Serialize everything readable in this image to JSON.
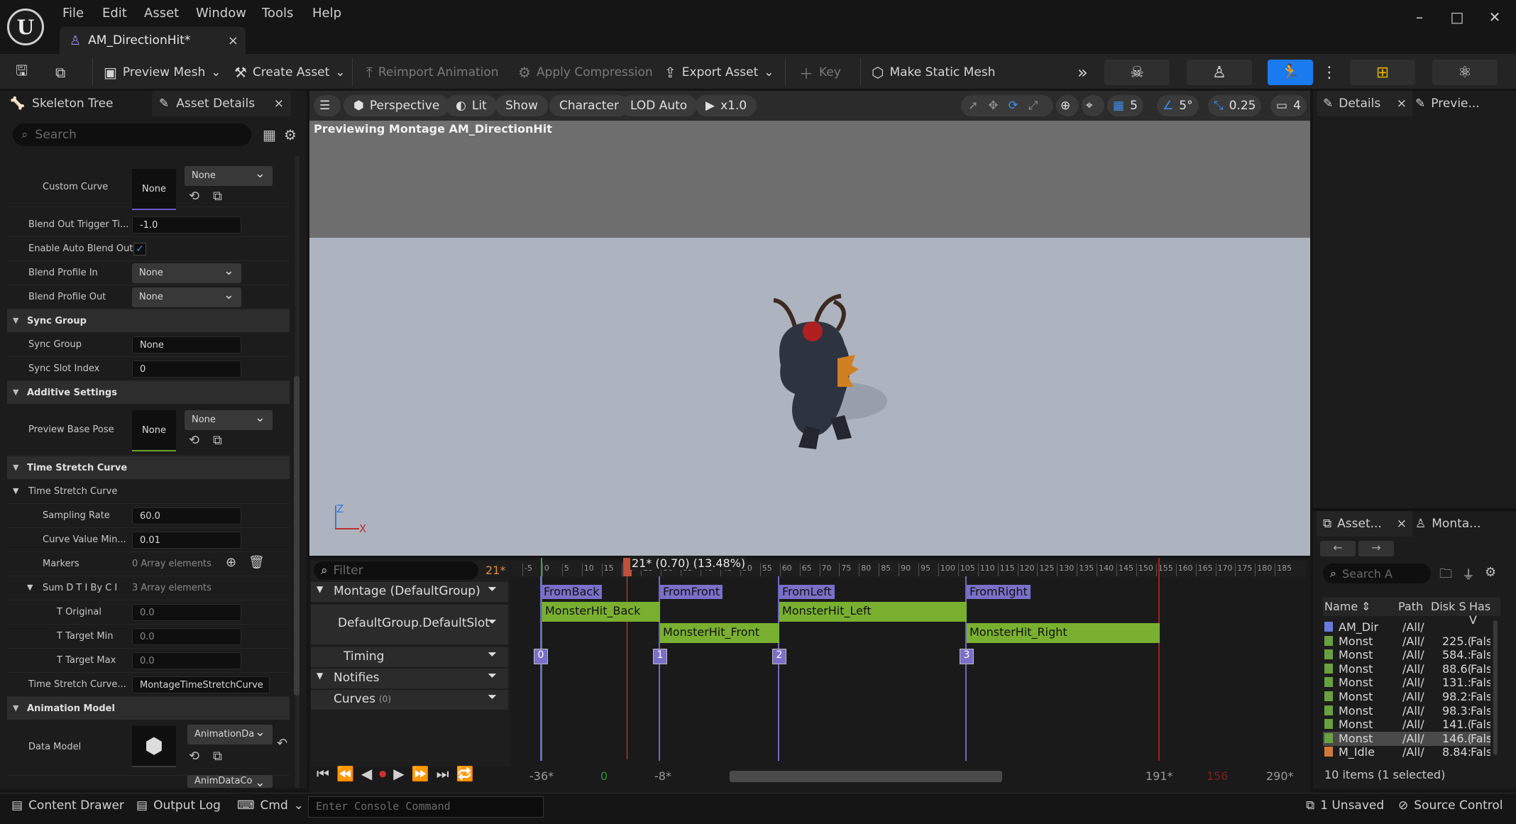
{
  "menu": [
    "File",
    "Edit",
    "Asset",
    "Window",
    "Tools",
    "Help"
  ],
  "document_tab": {
    "title": "AM_DirectionHit*",
    "close": "×"
  },
  "window_controls": {
    "minimize": "–",
    "maximize": "□",
    "close": "✕"
  },
  "toolbar": {
    "preview_mesh": "Preview Mesh",
    "create_asset": "Create Asset",
    "reimport": "Reimport Animation",
    "apply_compression": "Apply Compression",
    "export_asset": "Export Asset",
    "key": "Key",
    "make_static_mesh": "Make Static Mesh",
    "more": "»"
  },
  "left_panel": {
    "tabs": {
      "skeleton_tree": "Skeleton Tree",
      "asset_details": "Asset Details"
    },
    "search_placeholder": "Search",
    "custom_curve": {
      "label": "Custom Curve",
      "thumb": "None",
      "dropdown": "None"
    },
    "blend_out_trigger": {
      "label": "Blend Out Trigger Ti...",
      "value": "-1.0"
    },
    "enable_auto_blend_out": {
      "label": "Enable Auto Blend Out",
      "checked": true
    },
    "blend_profile_in": {
      "label": "Blend Profile In",
      "value": "None"
    },
    "blend_profile_out": {
      "label": "Blend Profile Out",
      "value": "None"
    },
    "sync_group_section": "Sync Group",
    "sync_group": {
      "label": "Sync Group",
      "value": "None"
    },
    "sync_slot_index": {
      "label": "Sync Slot Index",
      "value": "0"
    },
    "additive_section": "Additive Settings",
    "preview_base_pose": {
      "label": "Preview Base Pose",
      "thumb": "None",
      "dropdown": "None"
    },
    "time_stretch_section": "Time Stretch Curve",
    "time_stretch_sub": "Time Stretch Curve",
    "sampling_rate": {
      "label": "Sampling Rate",
      "value": "60.0"
    },
    "curve_value_min": {
      "label": "Curve Value Min...",
      "value": "0.01"
    },
    "markers": {
      "label": "Markers",
      "value": "0 Array elements"
    },
    "sum_dt": {
      "label": "Sum D T I By C I",
      "value": "3 Array elements"
    },
    "t_original": {
      "label": "T Original",
      "value": "0.0"
    },
    "t_target_min": {
      "label": "T Target Min",
      "value": "0.0"
    },
    "t_target_max": {
      "label": "T Target Max",
      "value": "0.0"
    },
    "time_stretch_curve_name": {
      "label": "Time Stretch Curve...",
      "value": "MontageTimeStretchCurve"
    },
    "animation_model_section": "Animation Model",
    "data_model": {
      "label": "Data Model",
      "dropdown": "AnimationDa",
      "dropdown2": "AnimDataCo"
    }
  },
  "viewport": {
    "perspective": "Perspective",
    "lit": "Lit",
    "show": "Show",
    "character": "Character",
    "lod": "LOD Auto",
    "speed": "x1.0",
    "grid_snap": "5",
    "rot_snap": "5°",
    "scale_snap": "0.25",
    "cam_speed": "4",
    "preview_label": "Previewing Montage AM_DirectionHit",
    "axis_z": "Z",
    "axis_x": "X"
  },
  "timeline": {
    "filter_placeholder": "Filter",
    "current_frame_badge": "21*",
    "playhead_label": "21* (0.70) (13.48%)",
    "ruler_ticks": [
      "-5",
      "0",
      "5",
      "10",
      "15",
      "20",
      "25",
      "30",
      "35",
      "40",
      "45",
      "50",
      "55",
      "60",
      "65",
      "70",
      "75",
      "80",
      "85",
      "90",
      "95",
      "100",
      "105",
      "110",
      "115",
      "120",
      "125",
      "130",
      "135",
      "140",
      "145",
      "150",
      "155",
      "160",
      "165",
      "170",
      "175",
      "180",
      "185"
    ],
    "tracks": {
      "montage": "Montage (DefaultGroup)",
      "slot": "DefaultGroup.DefaultSlot",
      "timing": "Timing",
      "notifies": "Notifies",
      "curves": "Curves",
      "curves_count": "(0)"
    },
    "sections": [
      "FromBack",
      "FromFront",
      "FromLeft",
      "FromRight"
    ],
    "segments_row1": [
      "MonsterHit_Back",
      "MonsterHit_Left"
    ],
    "segments_row2": [
      "MonsterHit_Front",
      "MonsterHit_Right"
    ],
    "timing_indices": [
      "0",
      "1",
      "2",
      "3"
    ],
    "range": {
      "start": "-36*",
      "zero": "0",
      "view_start": "-8*",
      "view_end": "191*",
      "end_marker": "156",
      "end": "290*"
    }
  },
  "right_panel": {
    "details_tab": "Details",
    "preview_tab": "Previe...",
    "asset_tab": "Asset...",
    "montage_tab": "Monta...",
    "search_placeholder": "Search A",
    "columns": [
      "Name",
      "Path",
      "Disk S",
      "Has V"
    ],
    "rows": [
      {
        "name": "AM_Dir",
        "path": "/All/",
        "disk": "",
        "has": ""
      },
      {
        "name": "Monst",
        "path": "/All/",
        "disk": "225.(",
        "has": "False"
      },
      {
        "name": "Monst",
        "path": "/All/",
        "disk": "584.:",
        "has": "False"
      },
      {
        "name": "Monst",
        "path": "/All/",
        "disk": "88.6(",
        "has": "False"
      },
      {
        "name": "Monst",
        "path": "/All/",
        "disk": "131.:",
        "has": "False"
      },
      {
        "name": "Monst",
        "path": "/All/",
        "disk": "98.2:",
        "has": "False"
      },
      {
        "name": "Monst",
        "path": "/All/",
        "disk": "98.3:",
        "has": "False"
      },
      {
        "name": "Monst",
        "path": "/All/",
        "disk": "141.(",
        "has": "False"
      },
      {
        "name": "Monst",
        "path": "/All/",
        "disk": "146.(",
        "has": "False"
      },
      {
        "name": "M_Idle",
        "path": "/All/",
        "disk": "8.84:",
        "has": "False"
      }
    ],
    "footer": "10 items (1 selected)"
  },
  "status_bar": {
    "content_drawer": "Content Drawer",
    "output_log": "Output Log",
    "cmd": "Cmd",
    "console_placeholder": "Enter Console Command",
    "unsaved": "1 Unsaved",
    "source_control": "Source Control"
  },
  "colors": {
    "accent": "#1a7bf0",
    "montage_section": "#7a70c8",
    "segment": "#7ab030",
    "playhead": "#c0503a"
  }
}
